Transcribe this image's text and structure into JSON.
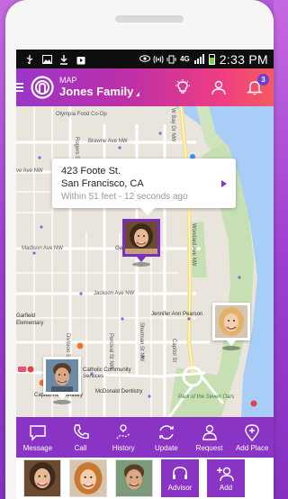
{
  "statusbar": {
    "time": "2:33 PM",
    "network": "4G"
  },
  "header": {
    "section": "MAP",
    "circle_name": "Jones Family",
    "notification_count": "3"
  },
  "callout": {
    "address_line1": "423 Foote St.",
    "address_line2": "San Francisco, CA",
    "meta": "Within 51 feet  -  12 seconds ago"
  },
  "map_labels": {
    "olympia": "Olympia Food Co-Op",
    "brawne": "Brawne Ave NW",
    "ave_nw_left": "ve Ave NW",
    "madison": "Madison Ave NW",
    "jackson": "Jackson Ave NW",
    "garfield": "Garfield Elementary",
    "jennifer": "Jennifer Ann Pearson",
    "catholic": "Catholic Community Services",
    "mcdonald": "McDonald Dentistry",
    "capitol": "Capitol Hill Dentistry",
    "park": "Park of the Seven Oars",
    "rogers": "Rogers St NW",
    "division": "Division St NW",
    "percival": "Percival St NW",
    "sherman": "Sherman St NW",
    "woodard": "Woodard Ave NW",
    "w_bay": "W Bay Dr NW",
    "garfield_tr": "Garfield Tr",
    "cap_st": "Capitol St"
  },
  "actions": [
    {
      "label": "Message",
      "icon": "message-icon"
    },
    {
      "label": "Call",
      "icon": "phone-icon"
    },
    {
      "label": "History",
      "icon": "history-icon"
    },
    {
      "label": "Update",
      "icon": "refresh-icon"
    },
    {
      "label": "Request",
      "icon": "request-person-icon"
    },
    {
      "label": "Add Place",
      "icon": "add-place-icon"
    }
  ],
  "people_buttons": {
    "advisor": "Advisor",
    "add": "Add"
  },
  "colors": {
    "brand_purple": "#8a34c6",
    "header_start": "#9a36c9",
    "header_end": "#f45a5e"
  }
}
